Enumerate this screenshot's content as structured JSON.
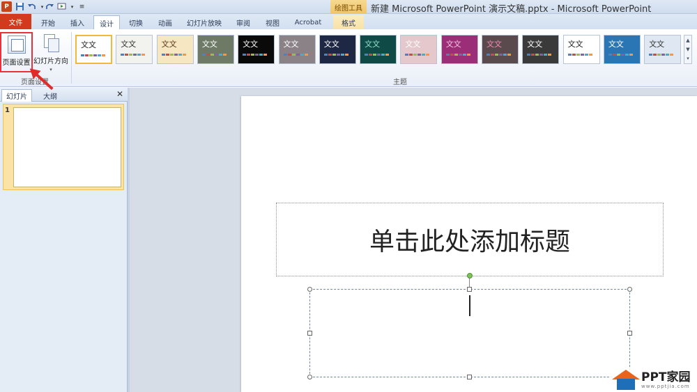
{
  "window": {
    "title": "新建 Microsoft PowerPoint 演示文稿.pptx - Microsoft PowerPoint",
    "context_tab_group": "绘图工具",
    "app_icon": "P"
  },
  "quick_access": [
    "save-icon",
    "undo-icon",
    "redo-icon",
    "customize-icon"
  ],
  "tabs": [
    {
      "label": "文件"
    },
    {
      "label": "开始"
    },
    {
      "label": "插入"
    },
    {
      "label": "设计"
    },
    {
      "label": "切换"
    },
    {
      "label": "动画"
    },
    {
      "label": "幻灯片放映"
    },
    {
      "label": "审阅"
    },
    {
      "label": "视图"
    },
    {
      "label": "Acrobat"
    },
    {
      "label": "格式"
    }
  ],
  "ribbon": {
    "page_setup_label": "页面设置",
    "orientation_label": "幻灯片方向",
    "group_page_setup": "页面设置",
    "group_themes": "主题",
    "themes": [
      {
        "text": "文文",
        "bg": "#ffffff",
        "fg": "#222222"
      },
      {
        "text": "文文",
        "bg": "#f2f2ee",
        "fg": "#333333"
      },
      {
        "text": "文文",
        "bg": "#f6e6c2",
        "fg": "#5a3c1a"
      },
      {
        "text": "文文",
        "bg": "#6e7a66",
        "fg": "#ffffff"
      },
      {
        "text": "文文",
        "bg": "#0a0a0a",
        "fg": "#ffffff"
      },
      {
        "text": "文文",
        "bg": "#8a8286",
        "fg": "#ffffff"
      },
      {
        "text": "文文",
        "bg": "#1e2844",
        "fg": "#ffffff"
      },
      {
        "text": "文文",
        "bg": "#0f4a46",
        "fg": "#8fe0c8"
      },
      {
        "text": "文文",
        "bg": "#e4c8cc",
        "fg": "#ffffff"
      },
      {
        "text": "文文",
        "bg": "#9c2e78",
        "fg": "#f1c3e0"
      },
      {
        "text": "文文",
        "bg": "#5a4a4e",
        "fg": "#f08ab0"
      },
      {
        "text": "文文",
        "bg": "#3a3a3a",
        "fg": "#ffffff"
      },
      {
        "text": "文文",
        "bg": "#ffffff",
        "fg": "#222222"
      },
      {
        "text": "文文",
        "bg": "#2a76b4",
        "fg": "#ffffff"
      },
      {
        "text": "文文",
        "bg": "#dfe8f2",
        "fg": "#333333"
      }
    ]
  },
  "left_panel": {
    "tab_slides": "幻灯片",
    "tab_outline": "大纲",
    "close": "✕",
    "slide_number": "1"
  },
  "slide": {
    "title_placeholder": "单击此处添加标题"
  },
  "watermark": {
    "name": "PPT家园",
    "url": "www.pptjia.com"
  },
  "colors": {
    "file_tab": "#d2391d",
    "highlight_box": "#e8313b",
    "arrow": "#e02b2b",
    "selected_theme_border": "#f0b93a"
  }
}
